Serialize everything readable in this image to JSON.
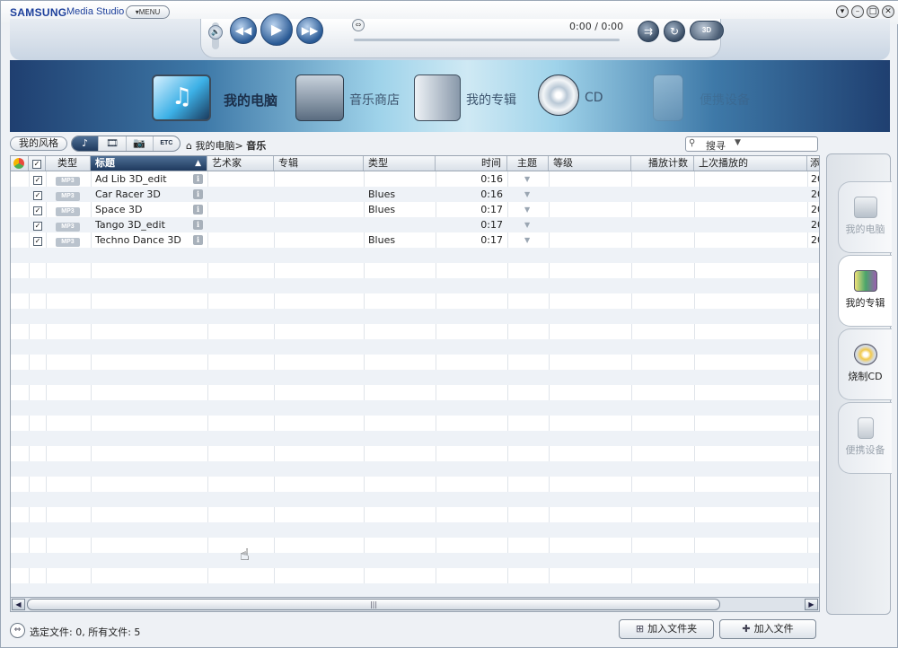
{
  "app": {
    "brand": "SAMSUNG",
    "product": "Media Studio",
    "menu_label": "MENU",
    "window_buttons": [
      "▾",
      "–",
      "□",
      "✕"
    ]
  },
  "player": {
    "time": "0:00 / 0:00",
    "btn_3d": "3D",
    "progress": 0
  },
  "banner": {
    "items": [
      {
        "label": "我的电脑",
        "icon": "computer-music-icon"
      },
      {
        "label": "音乐商店",
        "icon": "music-store-icon"
      },
      {
        "label": "我的专辑",
        "icon": "album-icon"
      },
      {
        "label": "CD",
        "icon": "cd-icon"
      },
      {
        "label": "便携设备",
        "icon": "portable-device-icon"
      }
    ]
  },
  "toolbar": {
    "style_label": "我的风格",
    "filters": [
      "♪",
      "🎞",
      "📷",
      "ETC"
    ],
    "breadcrumb_root": "我的电脑",
    "breadcrumb_sep": ">",
    "breadcrumb_current": "音乐",
    "search_label": "搜寻"
  },
  "table": {
    "columns": [
      "类型",
      "标题",
      "艺术家",
      "专辑",
      "类型",
      "时间",
      "主题",
      "等级",
      "播放计数",
      "上次播放的",
      "添"
    ],
    "rows": [
      {
        "checked": "✓",
        "type": "MP3",
        "title": "Ad Lib 3D_edit",
        "artist": "",
        "album": "",
        "genre": "",
        "time": "0:16",
        "added": "20"
      },
      {
        "checked": "✓",
        "type": "MP3",
        "title": "Car Racer 3D",
        "artist": "",
        "album": "",
        "genre": "Blues",
        "time": "0:16",
        "added": "20"
      },
      {
        "checked": "✓",
        "type": "MP3",
        "title": "Space 3D",
        "artist": "",
        "album": "",
        "genre": "Blues",
        "time": "0:17",
        "added": "20"
      },
      {
        "checked": "✓",
        "type": "MP3",
        "title": "Tango 3D_edit",
        "artist": "",
        "album": "",
        "genre": "",
        "time": "0:17",
        "added": "20"
      },
      {
        "checked": "✓",
        "type": "MP3",
        "title": "Techno Dance 3D",
        "artist": "",
        "album": "",
        "genre": "Blues",
        "time": "0:17",
        "added": "20"
      }
    ],
    "header_check": "✓"
  },
  "status": {
    "text": "选定文件:  0,  所有文件:  5",
    "add_folder": "加入文件夹",
    "add_file": "加入文件"
  },
  "right_panel": {
    "tabs": [
      {
        "label": "我的电脑",
        "state": "dim"
      },
      {
        "label": "我的专辑",
        "state": "normal"
      },
      {
        "label": "烧制CD",
        "state": "normal"
      },
      {
        "label": "便携设备",
        "state": "dim"
      }
    ]
  },
  "colors": {
    "accent": "#1f3a5e",
    "brand": "#1c3f9b",
    "row_alt": "#eef2f7"
  }
}
